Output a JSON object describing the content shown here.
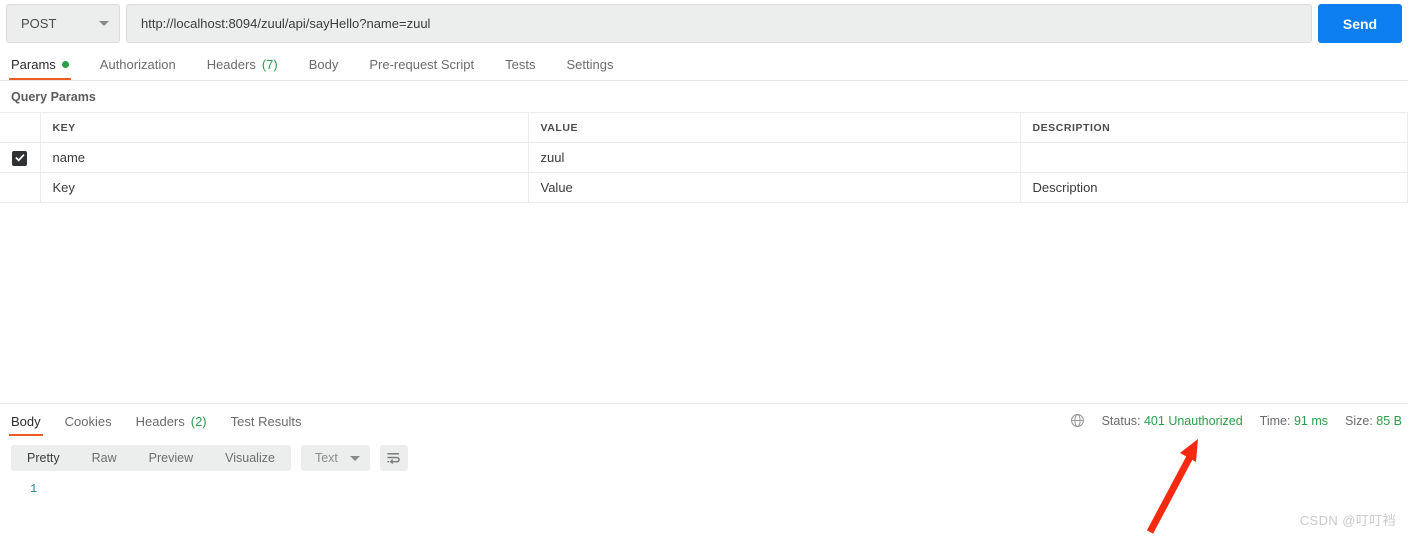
{
  "request": {
    "method": "POST",
    "url": "http://localhost:8094/zuul/api/sayHello?name=zuul",
    "send_label": "Send",
    "tabs": [
      {
        "label": "Params",
        "badge": "",
        "has_dot": true,
        "active": true
      },
      {
        "label": "Authorization",
        "badge": "",
        "has_dot": false,
        "active": false
      },
      {
        "label": "Headers",
        "badge": "(7)",
        "has_dot": false,
        "active": false
      },
      {
        "label": "Body",
        "badge": "",
        "has_dot": false,
        "active": false
      },
      {
        "label": "Pre-request Script",
        "badge": "",
        "has_dot": false,
        "active": false
      },
      {
        "label": "Tests",
        "badge": "",
        "has_dot": false,
        "active": false
      },
      {
        "label": "Settings",
        "badge": "",
        "has_dot": false,
        "active": false
      }
    ]
  },
  "params": {
    "section_title": "Query Params",
    "columns": [
      "KEY",
      "VALUE",
      "DESCRIPTION"
    ],
    "rows": [
      {
        "checked": true,
        "key": "name",
        "value": "zuul",
        "description": ""
      }
    ],
    "placeholder_row": {
      "key": "Key",
      "value": "Value",
      "description": "Description"
    }
  },
  "response": {
    "tabs": [
      {
        "label": "Body",
        "badge": "",
        "active": true
      },
      {
        "label": "Cookies",
        "badge": "",
        "active": false
      },
      {
        "label": "Headers",
        "badge": "(2)",
        "active": false
      },
      {
        "label": "Test Results",
        "badge": "",
        "active": false
      }
    ],
    "meta": {
      "status_label": "Status:",
      "status_value": "401 Unauthorized",
      "time_label": "Time:",
      "time_value": "91 ms",
      "size_label": "Size:",
      "size_value": "85 B"
    },
    "format_tabs": [
      {
        "label": "Pretty",
        "active": true
      },
      {
        "label": "Raw",
        "active": false
      },
      {
        "label": "Preview",
        "active": false
      },
      {
        "label": "Visualize",
        "active": false
      }
    ],
    "language_select": "Text",
    "body_lines": [
      {
        "number": "1",
        "text": ""
      }
    ]
  },
  "annotation": {
    "arrow_color": "#f52a11"
  },
  "watermark": "CSDN @叮叮裆",
  "colors": {
    "accent_orange": "#ef5b25",
    "send_blue": "#0d7ef0",
    "status_green": "#2a9d4c",
    "dot_green": "#26a244",
    "linenum_teal": "#1d86a0"
  }
}
